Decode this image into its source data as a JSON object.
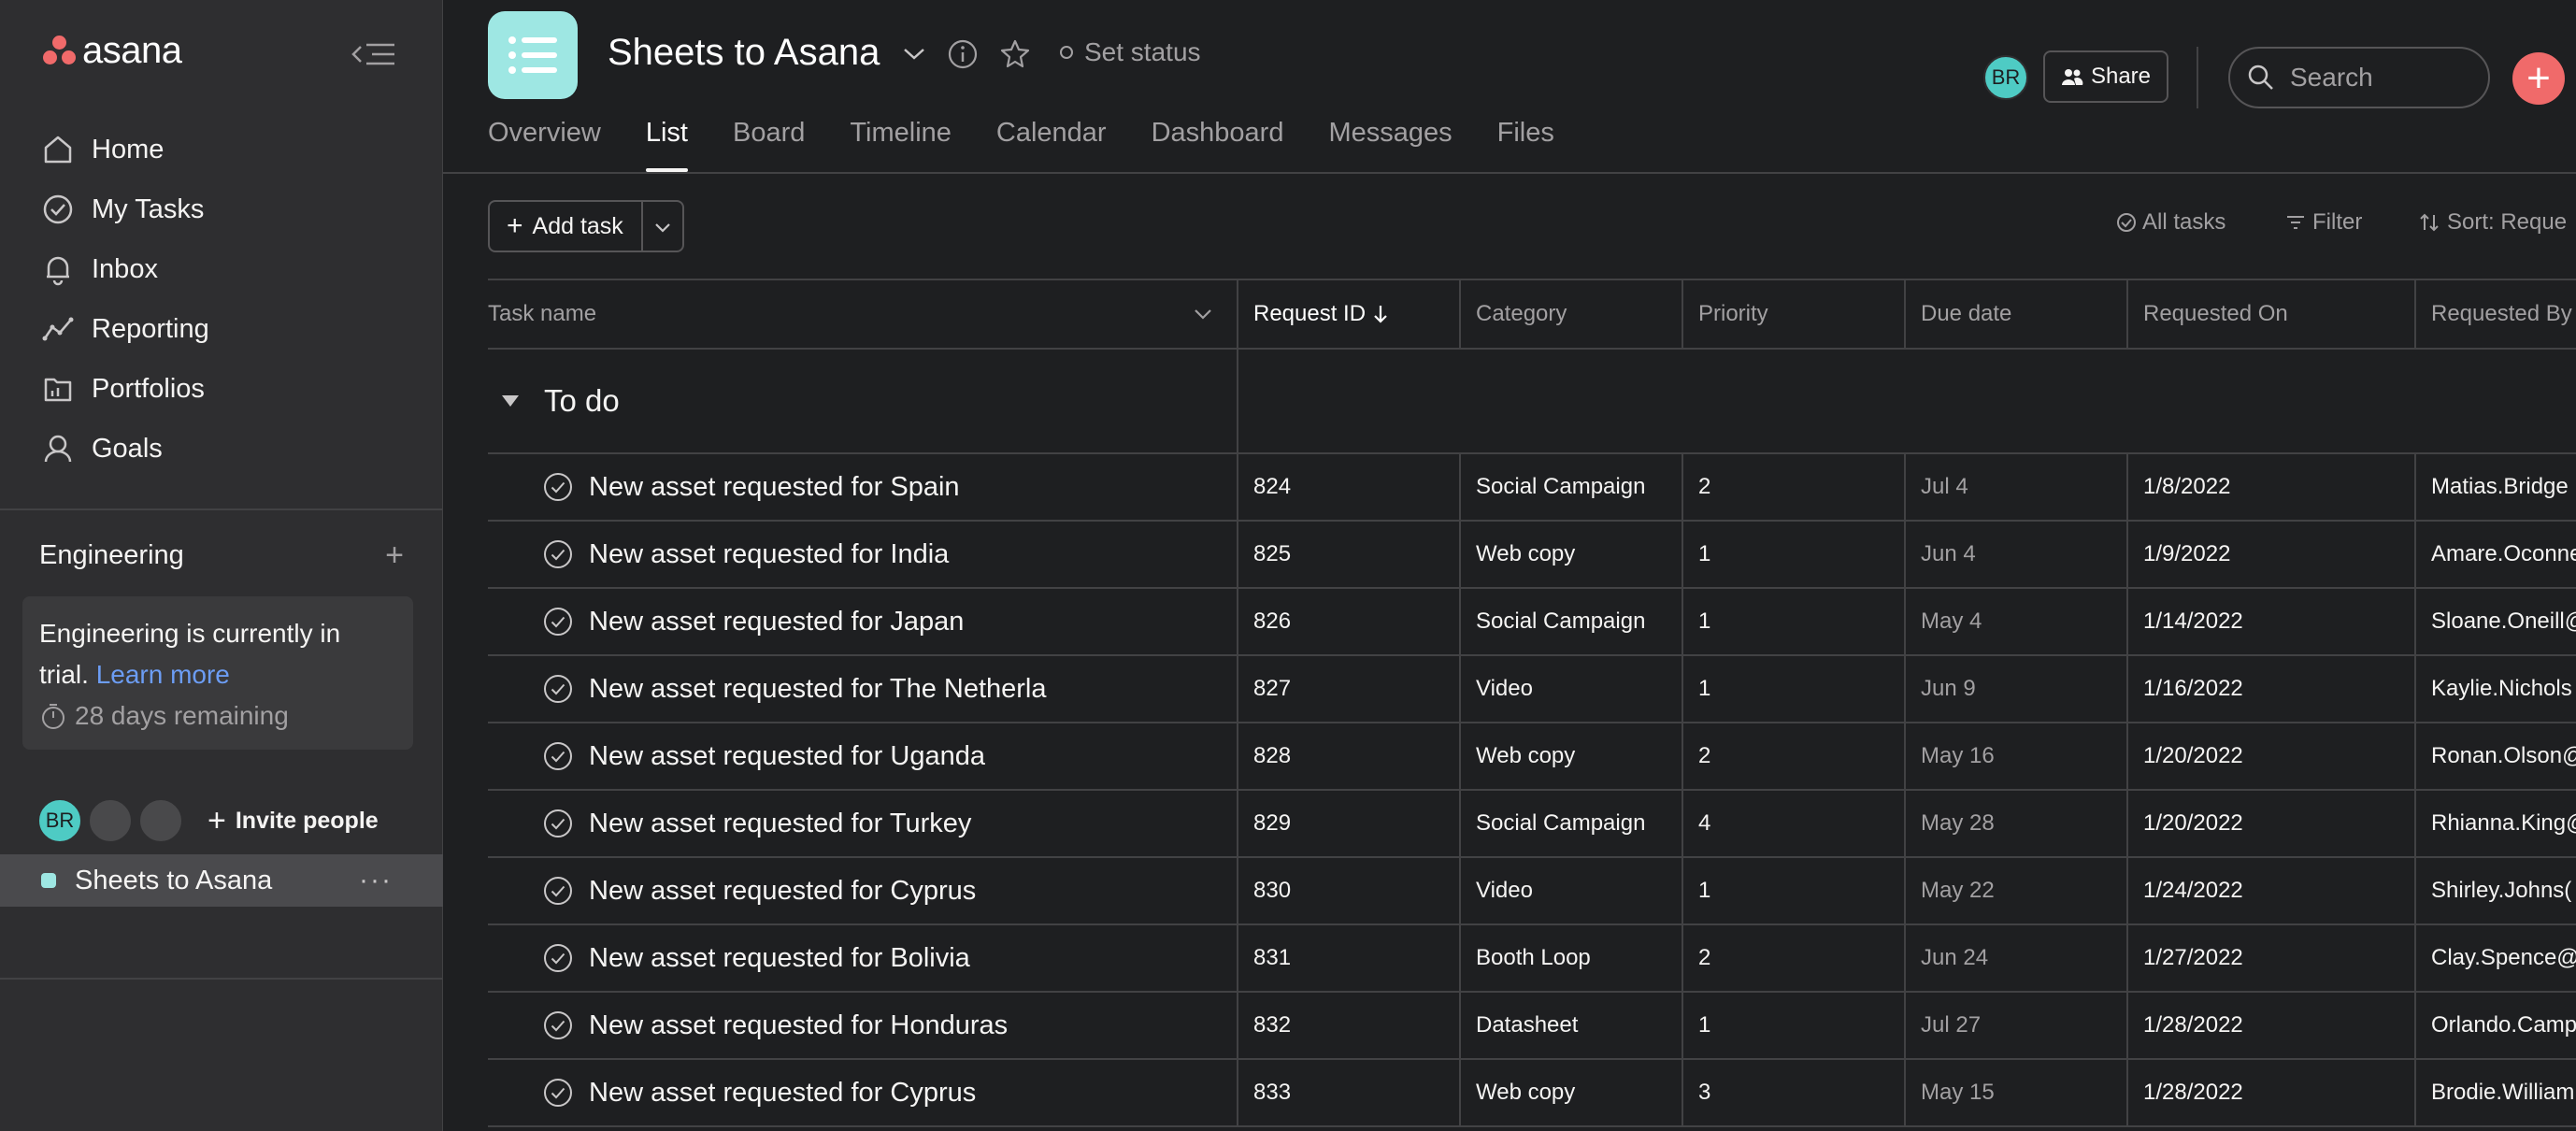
{
  "app": {
    "name": "asana"
  },
  "sidebar": {
    "nav": [
      {
        "label": "Home",
        "icon": "home-icon"
      },
      {
        "label": "My Tasks",
        "icon": "check-circle-icon"
      },
      {
        "label": "Inbox",
        "icon": "bell-icon"
      },
      {
        "label": "Reporting",
        "icon": "line-chart-icon"
      },
      {
        "label": "Portfolios",
        "icon": "folder-icon"
      },
      {
        "label": "Goals",
        "icon": "person-icon"
      }
    ],
    "team": {
      "name": "Engineering",
      "trial_text": "Engineering is currently in trial.",
      "learn_more": "Learn more",
      "remaining": "28 days remaining"
    },
    "members": {
      "initials": "BR",
      "invite_label": "Invite people"
    },
    "project": {
      "name": "Sheets to Asana"
    }
  },
  "header": {
    "title": "Sheets to Asana",
    "set_status": "Set status",
    "tabs": [
      "Overview",
      "List",
      "Board",
      "Timeline",
      "Calendar",
      "Dashboard",
      "Messages",
      "Files"
    ],
    "active_tab": "List",
    "avatar_initials": "BR",
    "share_label": "Share",
    "search_placeholder": "Search"
  },
  "toolbar": {
    "add_task_label": "Add task",
    "all_tasks_label": "All tasks",
    "filter_label": "Filter",
    "sort_label": "Sort: Reque"
  },
  "table": {
    "columns": [
      "Task name",
      "Request ID",
      "Category",
      "Priority",
      "Due date",
      "Requested On",
      "Requested By"
    ],
    "sorted_column": "Request ID",
    "section": "To do",
    "rows": [
      {
        "task": "New asset requested for Spain",
        "id": "824",
        "category": "Social Campaign",
        "priority": "2",
        "due": "Jul 4",
        "requested_on": "1/8/2022",
        "requested_by": "Matias.Bridge"
      },
      {
        "task": "New asset requested for India",
        "id": "825",
        "category": "Web copy",
        "priority": "1",
        "due": "Jun 4",
        "requested_on": "1/9/2022",
        "requested_by": "Amare.Oconne"
      },
      {
        "task": "New asset requested for Japan",
        "id": "826",
        "category": "Social Campaign",
        "priority": "1",
        "due": "May 4",
        "requested_on": "1/14/2022",
        "requested_by": "Sloane.Oneill@"
      },
      {
        "task": "New asset requested for The Netherla",
        "id": "827",
        "category": "Video",
        "priority": "1",
        "due": "Jun 9",
        "requested_on": "1/16/2022",
        "requested_by": "Kaylie.Nichols"
      },
      {
        "task": "New asset requested for Uganda",
        "id": "828",
        "category": "Web copy",
        "priority": "2",
        "due": "May 16",
        "requested_on": "1/20/2022",
        "requested_by": "Ronan.Olson@"
      },
      {
        "task": "New asset requested for Turkey",
        "id": "829",
        "category": "Social Campaign",
        "priority": "4",
        "due": "May 28",
        "requested_on": "1/20/2022",
        "requested_by": "Rhianna.King@"
      },
      {
        "task": "New asset requested for Cyprus",
        "id": "830",
        "category": "Video",
        "priority": "1",
        "due": "May 22",
        "requested_on": "1/24/2022",
        "requested_by": "Shirley.Johns("
      },
      {
        "task": "New asset requested for Bolivia",
        "id": "831",
        "category": "Booth Loop",
        "priority": "2",
        "due": "Jun 24",
        "requested_on": "1/27/2022",
        "requested_by": "Clay.Spence@"
      },
      {
        "task": "New asset requested for Honduras",
        "id": "832",
        "category": "Datasheet",
        "priority": "1",
        "due": "Jul 27",
        "requested_on": "1/28/2022",
        "requested_by": "Orlando.Camp"
      },
      {
        "task": "New asset requested for Cyprus",
        "id": "833",
        "category": "Web copy",
        "priority": "3",
        "due": "May 15",
        "requested_on": "1/28/2022",
        "requested_by": "Brodie.William"
      }
    ]
  },
  "colors": {
    "accent": "#f06a6a",
    "project": "#9ee7e3",
    "avatar": "#4ecbc4",
    "link": "#6c9df4"
  }
}
